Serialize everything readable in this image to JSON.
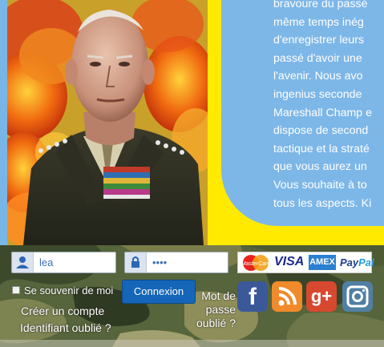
{
  "article": {
    "lines": [
      "bravoure du passé",
      "même temps inég",
      "d'enregistrer leurs",
      "passé d'avoir une",
      "l'avenir. Nous avo",
      "ingenius seconde",
      "Mareshall Champ e",
      "dispose de second",
      "tactique et la straté",
      "que vous aurez un",
      "Vous souhaite à to",
      "tous les aspects. Ki"
    ]
  },
  "login": {
    "username_value": "lea",
    "password_value": "••••",
    "remember_label": "Se souvenir de moi",
    "submit_label": "Connexion",
    "create_account_label": "Créer un compte",
    "forgot_id_label": "Identifiant oublié ?",
    "forgot_password_label": "Mot de\npasse\noublié ?"
  },
  "payments": {
    "mastercard": "MasterCard",
    "visa": "VISA",
    "amex": "AMEX",
    "paypal_pay": "Pay",
    "paypal_pal": "Pal"
  },
  "social": {
    "facebook_glyph": "f",
    "googleplus_glyph": "g+"
  },
  "colors": {
    "blue_panel": "#7db7e8",
    "yellow_border": "#ffea00",
    "button_blue": "#1565b8",
    "facebook": "#3b5998",
    "rss": "#f08a2a",
    "googleplus": "#d6492f",
    "instagram": "#517fa4"
  }
}
